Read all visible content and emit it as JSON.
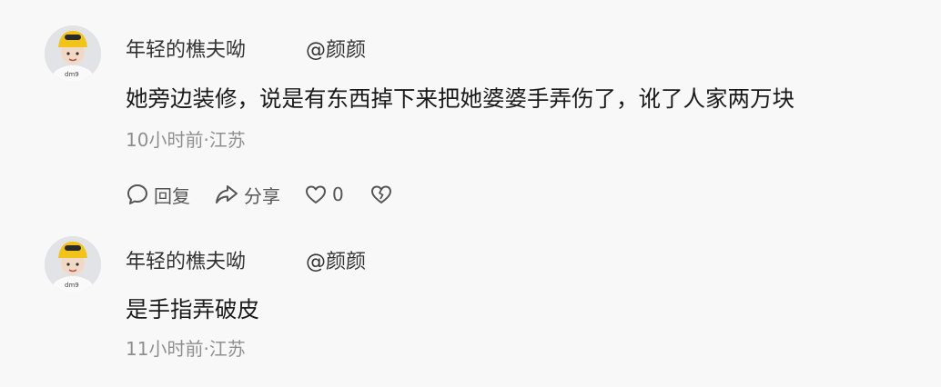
{
  "comments": [
    {
      "username": "年轻的樵夫呦",
      "mention": "@颜颜",
      "text": "她旁边装修，说是有东西掉下来把她婆婆手弄伤了，讹了人家两万块",
      "meta": "10小时前·江苏",
      "actions": {
        "reply_label": "回复",
        "share_label": "分享",
        "like_count": "0"
      }
    },
    {
      "username": "年轻的樵夫呦",
      "mention": "@颜颜",
      "text": "是手指弄破皮",
      "meta": "11小时前·江苏"
    }
  ],
  "icons": {
    "reply": "comment-bubble-icon",
    "share": "share-arrow-icon",
    "like": "heart-outline-icon",
    "dislike": "broken-heart-icon"
  },
  "colors": {
    "background": "#f8f8f8",
    "primary_text": "#1a1a1a",
    "secondary_text": "#8f8f8f",
    "avatar_hat": "#f2c318"
  }
}
